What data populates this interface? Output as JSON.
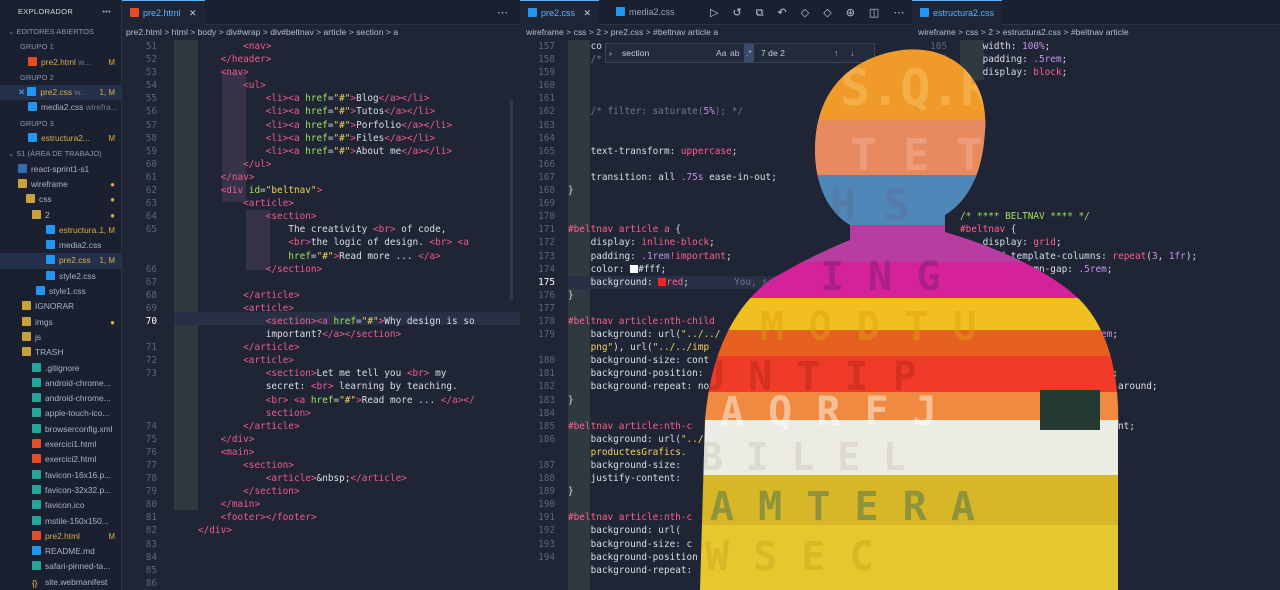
{
  "explorer": {
    "title": "EXPLORADOR",
    "open_editors": "EDITORES ABIERTOS",
    "groups": [
      {
        "label": "GRUPO 1",
        "file": "pre2.html",
        "detail": "w...",
        "mark": "M"
      },
      {
        "label": "GRUPO 2",
        "file": "pre2.css",
        "detail": "w...",
        "mark": "1, M",
        "file2": "media2.css",
        "detail2": "wirefra..."
      },
      {
        "label": "GRUPO 3",
        "file": "estructura2...",
        "mark": "M"
      }
    ],
    "workspace": "S1 (ÁREA DE TRABAJO)",
    "tree": [
      {
        "name": "react-sprint1-s1",
        "type": "repo"
      },
      {
        "name": "wireframe",
        "type": "folder-open",
        "dot": true
      },
      {
        "name": "css",
        "type": "folder-open",
        "dot": true
      },
      {
        "name": "2",
        "type": "folder-open",
        "dot": true
      },
      {
        "name": "estructura...",
        "type": "css",
        "mark": "1, M"
      },
      {
        "name": "media2.css",
        "type": "css"
      },
      {
        "name": "pre2.css",
        "type": "css",
        "mark": "1, M"
      },
      {
        "name": "style2.css",
        "type": "css"
      },
      {
        "name": "style1.css",
        "type": "css"
      },
      {
        "name": "IGNORAR",
        "type": "folder"
      },
      {
        "name": "imgs",
        "type": "folder",
        "dot": true
      },
      {
        "name": "js",
        "type": "folder"
      },
      {
        "name": "TRASH",
        "type": "folder"
      },
      {
        "name": ".gitignore",
        "type": "file"
      },
      {
        "name": "android-chrome...",
        "type": "img"
      },
      {
        "name": "android-chrome...",
        "type": "img"
      },
      {
        "name": "apple-touch-ico...",
        "type": "img"
      },
      {
        "name": "browserconfig.xml",
        "type": "file"
      },
      {
        "name": "exercici1.html",
        "type": "html"
      },
      {
        "name": "exercici2.html",
        "type": "html"
      },
      {
        "name": "favicon-16x16.p...",
        "type": "img"
      },
      {
        "name": "favicon-32x32.p...",
        "type": "img"
      },
      {
        "name": "favicon.ico",
        "type": "img"
      },
      {
        "name": "mstile-150x150...",
        "type": "img"
      },
      {
        "name": "pre2.html",
        "type": "html",
        "mark": "M"
      },
      {
        "name": "README.md",
        "type": "info"
      },
      {
        "name": "safari-pinned-ta...",
        "type": "img"
      },
      {
        "name": "site.webmanifest",
        "type": "json"
      }
    ]
  },
  "editor1": {
    "tab": "pre2.html",
    "breadcrumb": "pre2.html > html > body > div#wrap > div#beltnav > article > section > a",
    "lines": [
      "51",
      "52",
      "53",
      "54",
      "55",
      "56",
      "57",
      "58",
      "59",
      "60",
      "61",
      "62",
      "63",
      "64",
      "65",
      "",
      "",
      "66",
      "67",
      "68",
      "69",
      "70",
      "",
      "71",
      "72",
      "73",
      "",
      "",
      "",
      "74",
      "75",
      "76",
      "77",
      "78",
      "79",
      "80",
      "81",
      "82",
      "83",
      "84",
      "85",
      "86"
    ],
    "current_line": "70"
  },
  "editor2": {
    "tab": "pre2.css",
    "tab2": "media2.css",
    "breadcrumb": "wireframe > css > 2 > pre2.css > #beltnav article a",
    "find_text": "section",
    "find_options": [
      "Aa",
      "ab",
      ".*"
    ],
    "find_count": "7 de 2",
    "lines": [
      "157",
      "158",
      "159",
      "160",
      "161",
      "162",
      "163",
      "164",
      "165",
      "166",
      "167",
      "168",
      "169",
      "170",
      "171",
      "172",
      "173",
      "174",
      "175",
      "176",
      "177",
      "178",
      "179",
      "",
      "180",
      "181",
      "182",
      "183",
      "184",
      "185",
      "186",
      "",
      "187",
      "188",
      "189",
      "190",
      "191",
      "192",
      "193",
      "194"
    ],
    "current_line": "175",
    "inline_hint": "You, se"
  },
  "editor3": {
    "tab": "estructura2.css",
    "breadcrumb": "wireframe > css > 2 > estructura2.css > #beltnav article",
    "lines": [
      "105",
      "106",
      "107"
    ]
  },
  "colors": {
    "accent": "#5ab4ff",
    "tag": "#f25a8a",
    "attr": "#9fe35f",
    "string": "#f0d25c",
    "selector": "#ff5f8c"
  }
}
